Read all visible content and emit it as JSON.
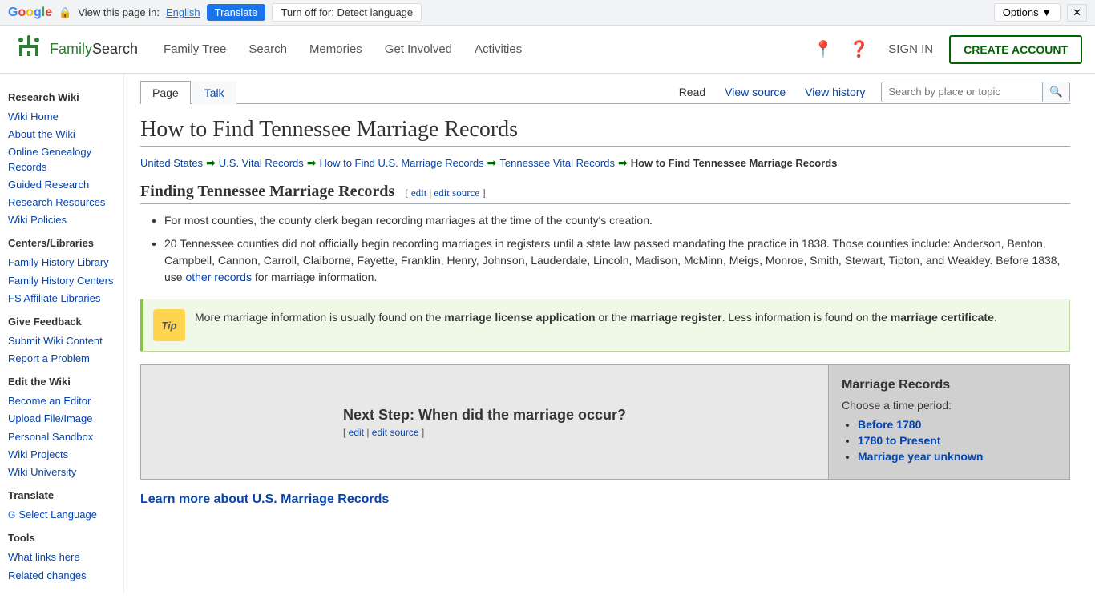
{
  "translate_bar": {
    "view_text": "View this page in:",
    "language": "English",
    "translate_btn": "Translate",
    "turnoff_btn": "Turn off for: Detect language",
    "options_btn": "Options",
    "close_btn": "✕"
  },
  "header": {
    "logo_text_family": "Family",
    "logo_text_search": "Search",
    "nav_items": [
      "Family Tree",
      "Search",
      "Memories",
      "Get Involved",
      "Activities"
    ],
    "sign_in": "SIGN IN",
    "create_account": "CREATE ACCOUNT"
  },
  "sidebar": {
    "sections": [
      {
        "title": "Research Wiki",
        "links": [
          {
            "label": "Wiki Home",
            "href": "#"
          },
          {
            "label": "About the Wiki",
            "href": "#"
          },
          {
            "label": "Online Genealogy Records",
            "href": "#"
          },
          {
            "label": "Guided Research",
            "href": "#"
          },
          {
            "label": "Research Resources",
            "href": "#"
          },
          {
            "label": "Wiki Policies",
            "href": "#"
          }
        ]
      },
      {
        "title": "Centers/Libraries",
        "links": [
          {
            "label": "Family History Library",
            "href": "#"
          },
          {
            "label": "Family History Centers",
            "href": "#"
          },
          {
            "label": "FS Affiliate Libraries",
            "href": "#"
          }
        ]
      },
      {
        "title": "Give Feedback",
        "links": [
          {
            "label": "Submit Wiki Content",
            "href": "#"
          },
          {
            "label": "Report a Problem",
            "href": "#"
          }
        ]
      },
      {
        "title": "Edit the Wiki",
        "links": [
          {
            "label": "Become an Editor",
            "href": "#"
          },
          {
            "label": "Upload File/Image",
            "href": "#"
          },
          {
            "label": "Personal Sandbox",
            "href": "#"
          },
          {
            "label": "Wiki Projects",
            "href": "#"
          },
          {
            "label": "Wiki University",
            "href": "#"
          }
        ]
      },
      {
        "title": "Translate",
        "links": [
          {
            "label": "Select Language",
            "href": "#"
          }
        ]
      },
      {
        "title": "Tools",
        "links": [
          {
            "label": "What links here",
            "href": "#"
          },
          {
            "label": "Related changes",
            "href": "#"
          }
        ]
      }
    ]
  },
  "page_tabs": {
    "tabs": [
      {
        "label": "Page",
        "active": true
      },
      {
        "label": "Talk",
        "active": false
      }
    ],
    "actions": [
      {
        "label": "Read",
        "active": true
      },
      {
        "label": "View source",
        "active": false
      },
      {
        "label": "View history",
        "active": false
      }
    ],
    "search_placeholder": "Search by place or topic"
  },
  "article": {
    "title": "How to Find Tennessee Marriage Records",
    "breadcrumb": [
      {
        "label": "United States",
        "href": "#"
      },
      {
        "label": "U.S. Vital Records",
        "href": "#"
      },
      {
        "label": "How to Find U.S. Marriage Records",
        "href": "#"
      },
      {
        "label": "Tennessee Vital Records",
        "href": "#"
      },
      {
        "label": "How to Find Tennessee Marriage Records",
        "current": true
      }
    ],
    "section1": {
      "title": "Finding Tennessee Marriage Records",
      "edit_link": "edit",
      "edit_source_link": "edit source",
      "bullets": [
        "For most counties, the county clerk began recording marriages at the time of the county's creation.",
        "20 Tennessee counties did not officially begin recording marriages in registers until a state law passed mandating the practice in 1838. Those counties include: Anderson, Benton, Campbell, Cannon, Carroll, Claiborne, Fayette, Franklin, Henry, Johnson, Lauderdale, Lincoln, Madison, McMinn, Meigs, Monroe, Smith, Stewart, Tipton, and Weakley. Before 1838, use other records for marriage information."
      ],
      "other_records_link": "other records"
    },
    "tip_box": {
      "icon_text": "Tip",
      "text_before": "More marriage information is usually found on the ",
      "bold1": "marriage license application",
      "text_mid1": " or the ",
      "bold2": "marriage register",
      "text_mid2": ". Less information is found on the ",
      "bold3": "marriage certificate",
      "text_after": "."
    },
    "table": {
      "left_text": "Next Step: When did the marriage occur?",
      "left_edit": "edit",
      "left_edit_source": "edit source",
      "right_title": "Marriage Records",
      "right_subtitle": "Choose a time period:",
      "right_links": [
        {
          "label": "Before 1780",
          "href": "#"
        },
        {
          "label": "1780 to Present",
          "href": "#"
        },
        {
          "label": "Marriage year unknown",
          "href": "#"
        }
      ]
    },
    "learn_more": "Learn more about U.S. Marriage Records"
  }
}
